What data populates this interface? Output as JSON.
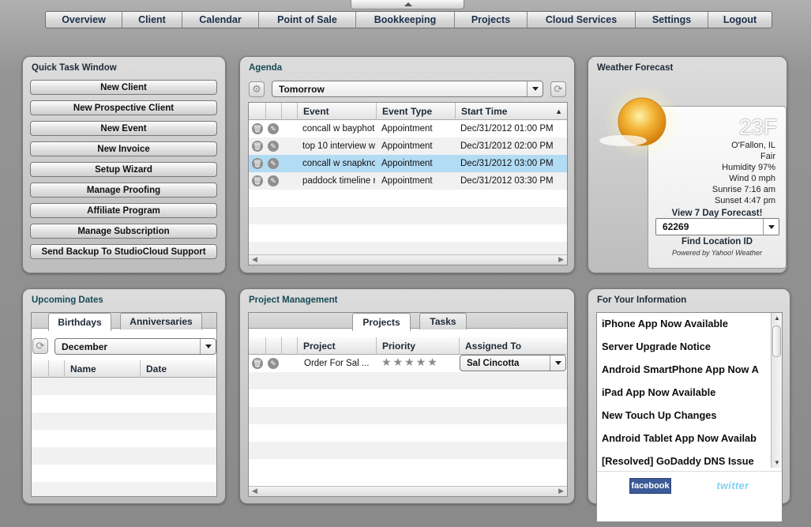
{
  "nav": [
    "Overview",
    "Client",
    "Calendar",
    "Point of Sale",
    "Bookkeeping",
    "Projects",
    "Cloud Services",
    "Settings",
    "Logout"
  ],
  "quick_task": {
    "title": "Quick Task Window",
    "buttons": [
      "New Client",
      "New Prospective Client",
      "New Event",
      "New Invoice",
      "Setup Wizard",
      "Manage Proofing",
      "Affiliate Program",
      "Manage Subscription",
      "Send Backup To StudioCloud Support"
    ]
  },
  "agenda": {
    "title": "Agenda",
    "range": "Tomorrow",
    "columns": [
      "Event",
      "Event Type",
      "Start Time"
    ],
    "sort_arrow": "▲",
    "rows": [
      {
        "event": "concall w bayphot",
        "type": "Appointment",
        "start": "Dec/31/2012 01:00 PM"
      },
      {
        "event": "top 10 interview w",
        "type": "Appointment",
        "start": "Dec/31/2012 02:00 PM"
      },
      {
        "event": "concall w snapkno",
        "type": "Appointment",
        "start": "Dec/31/2012 03:00 PM"
      },
      {
        "event": "paddock timeline r",
        "type": "Appointment",
        "start": "Dec/31/2012 03:30 PM"
      }
    ],
    "selected_row": 2
  },
  "weather": {
    "title": "Weather Forecast",
    "temp": "23F",
    "location": "O'Fallon, IL",
    "condition": "Fair",
    "humidity": "Humidity 97%",
    "wind": "Wind 0 mph",
    "sunrise": "Sunrise 7:16 am",
    "sunset": "Sunset 4:47 pm",
    "forecast_link": "View 7 Day Forecast!",
    "location_id": "62269",
    "find_link": "Find Location ID",
    "powered": "Powered by Yahoo! Weather"
  },
  "upcoming": {
    "title": "Upcoming Dates",
    "tabs": [
      "Birthdays",
      "Anniversaries"
    ],
    "month": "December",
    "columns": [
      "Name",
      "Date"
    ]
  },
  "projects": {
    "title": "Project Management",
    "tabs": [
      "Projects",
      "Tasks"
    ],
    "columns": [
      "Project",
      "Priority",
      "Assigned To"
    ],
    "rows": [
      {
        "project": "Order For Sal ...",
        "priority_stars": 5,
        "assigned": "Sal Cincotta"
      }
    ]
  },
  "info": {
    "title": "For Your Information",
    "items": [
      "iPhone App Now Available",
      "Server Upgrade Notice",
      "Android SmartPhone App Now A",
      "iPad App Now Available",
      "New Touch Up Changes",
      "Android Tablet App Now Availab",
      "[Resolved] GoDaddy DNS Issue"
    ],
    "facebook": "facebook",
    "twitter": "twitter"
  },
  "icons": {
    "trash": "trash-icon",
    "edit": "pencil-icon",
    "refresh": "refresh-icon",
    "gear": "gear-icon"
  }
}
